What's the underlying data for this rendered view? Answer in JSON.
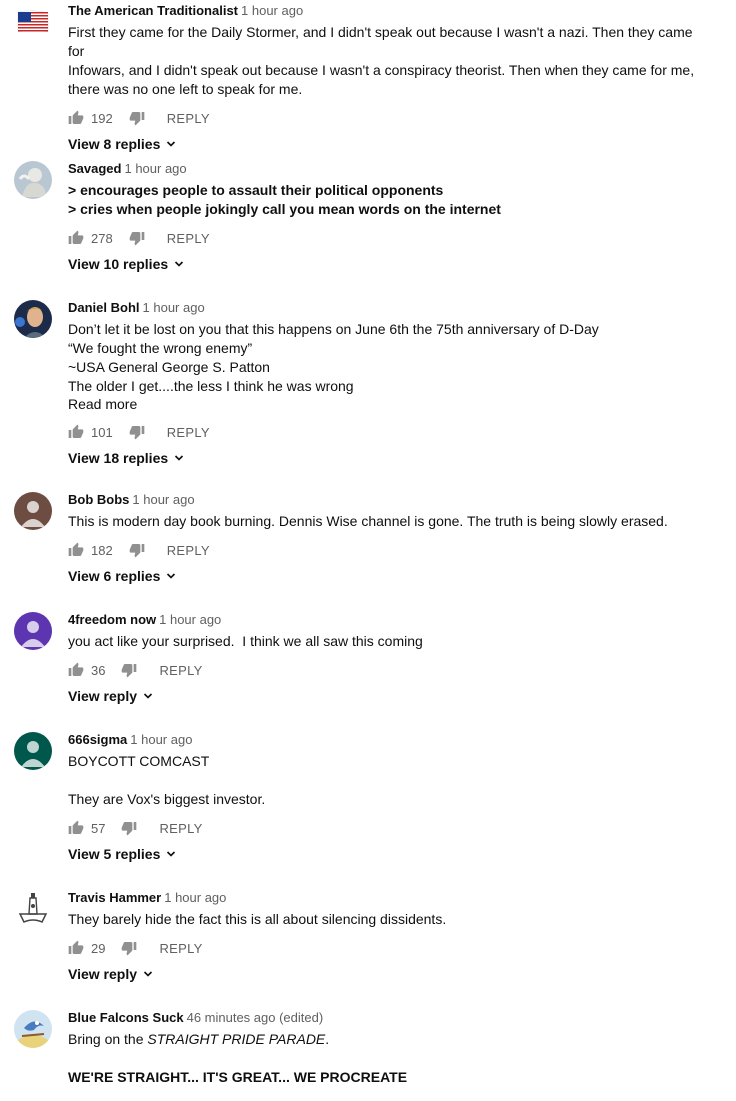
{
  "comments": [
    {
      "author": "The American Traditionalist",
      "time": "1 hour ago",
      "avatar": "flag-avatar",
      "lines": [
        "First they came for the Daily Stormer, and I didn't speak out because I wasn't a nazi. Then they came for",
        "Infowars, and I didn't speak out because I wasn't a conspiracy theorist. Then when they came for me,",
        "there was no one left to speak for me."
      ],
      "likes": "192",
      "reply": "REPLY",
      "replies": "View 8 replies"
    },
    {
      "author": "Savaged",
      "time": "1 hour ago",
      "avatar": "statue-avatar",
      "lines": [
        "> encourages people to assault their political opponents",
        "> cries when people jokingly call you mean words on the internet"
      ],
      "likes": "278",
      "reply": "REPLY",
      "replies": "View 10 replies"
    },
    {
      "author": "Daniel Bohl",
      "time": "1 hour ago",
      "avatar": "photo-avatar",
      "lines": [
        "Don’t let it be lost on you that this happens on June 6th the 75th anniversary of D-Day",
        "“We fought the wrong enemy”",
        "~USA General George S. Patton",
        "The older I get....the less I think he was wrong"
      ],
      "read_more": "Read more",
      "likes": "101",
      "reply": "REPLY",
      "replies": "View 18 replies"
    },
    {
      "author": "Bob Bobs",
      "time": "1 hour ago",
      "avatar": "default-avatar",
      "avatar_color": "#6d4c41",
      "lines": [
        "This is modern day book burning. Dennis Wise channel is gone. The truth is being slowly erased."
      ],
      "likes": "182",
      "reply": "REPLY",
      "replies": "View 6 replies"
    },
    {
      "author": "4freedom now",
      "time": "1 hour ago",
      "avatar": "default-avatar",
      "avatar_color": "#5e35b1",
      "lines": [
        "you act like your surprised.  I think we all saw this coming"
      ],
      "likes": "36",
      "reply": "REPLY",
      "replies": "View reply"
    },
    {
      "author": "666sigma",
      "time": "1 hour ago",
      "avatar": "default-avatar",
      "avatar_color": "#00574b",
      "lines": [
        "BOYCOTT COMCAST",
        "",
        "They are Vox's biggest investor."
      ],
      "likes": "57",
      "reply": "REPLY",
      "replies": "View 5 replies"
    },
    {
      "author": "Travis Hammer",
      "time": "1 hour ago",
      "avatar": "hammer-avatar",
      "lines": [
        "They barely hide the fact this is all about silencing dissidents."
      ],
      "likes": "29",
      "reply": "REPLY",
      "replies": "View reply"
    },
    {
      "author": "Blue Falcons Suck",
      "time": "46 minutes ago (edited)",
      "avatar": "cartoon-avatar",
      "lines_rich": [
        {
          "pre": "Bring on the ",
          "em": "STRAIGHT PRIDE PARADE",
          "post": "."
        },
        {
          "gap": true
        },
        {
          "bold": "WE'RE STRAIGHT... IT'S GREAT... WE PROCREATE"
        }
      ]
    }
  ],
  "colors": {
    "text": "#0f0f0f",
    "secondary": "#606060",
    "icon": "#909090"
  }
}
